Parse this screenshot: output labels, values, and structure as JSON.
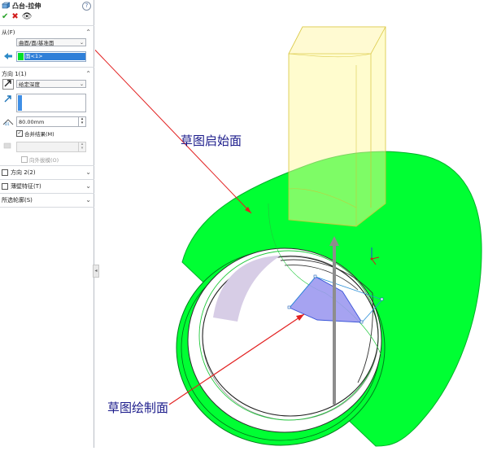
{
  "panel": {
    "title": "凸台-拉伸",
    "help": "?",
    "from": {
      "section_label": "从(F)",
      "start_condition": "曲面/面/基准面",
      "selection": "面<1>"
    },
    "direction1": {
      "section_label": "方向 1(1)",
      "end_condition": "给定深度",
      "depth": "80.00mm",
      "merge_label": "合并结果(M)",
      "draft_outward_label": "向外拔模(O)"
    },
    "direction2": {
      "label": "方向 2(2)"
    },
    "thin_feature": {
      "label": "薄壁特征(T)"
    },
    "selected_contours": {
      "label": "所选轮廓(S)"
    }
  },
  "viewport": {
    "annotations": {
      "sketch_start_face": "草图启始面",
      "sketch_plane": "草图绘制面"
    }
  },
  "colors": {
    "extrude_green": "#00ff33",
    "preview_yellow": "#fff79a",
    "arrow_red": "#e22020",
    "sketch_fill": "#9c99f0",
    "accent_blue": "#2f7fd8"
  }
}
